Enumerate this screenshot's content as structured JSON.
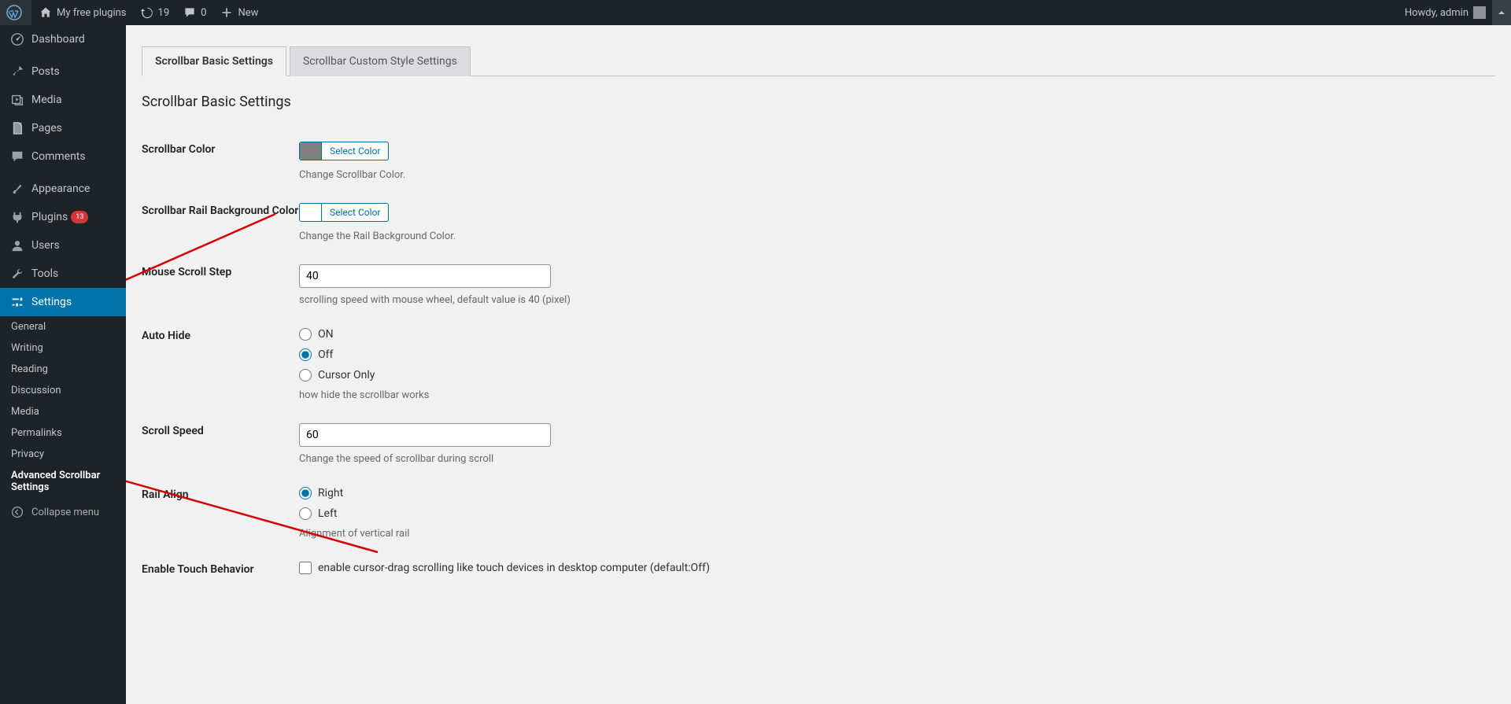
{
  "adminbar": {
    "site_name": "My free plugins",
    "updates_count": "19",
    "comments_count": "0",
    "new_label": "New",
    "howdy": "Howdy, admin"
  },
  "sidemenu": {
    "dashboard": "Dashboard",
    "posts": "Posts",
    "media": "Media",
    "pages": "Pages",
    "comments": "Comments",
    "appearance": "Appearance",
    "plugins": "Plugins",
    "plugins_badge": "13",
    "users": "Users",
    "tools": "Tools",
    "settings": "Settings",
    "sub_general": "General",
    "sub_writing": "Writing",
    "sub_reading": "Reading",
    "sub_discussion": "Discussion",
    "sub_media": "Media",
    "sub_permalinks": "Permalinks",
    "sub_privacy": "Privacy",
    "sub_advanced": "Advanced Scrollbar Settings",
    "collapse": "Collapse menu"
  },
  "tabs": {
    "basic": "Scrollbar Basic Settings",
    "custom": "Scrollbar Custom Style Settings"
  },
  "section_title": "Scrollbar Basic Settings",
  "fields": {
    "color": {
      "label": "Scrollbar Color",
      "button": "Select Color",
      "desc": "Change Scrollbar Color."
    },
    "rail_bg": {
      "label": "Scrollbar Rail Background Color",
      "button": "Select Color",
      "desc": "Change the Rail Background Color."
    },
    "scroll_step": {
      "label": "Mouse Scroll Step",
      "value": "40",
      "desc": "scrolling speed with mouse wheel, default value is 40 (pixel)"
    },
    "autohide": {
      "label": "Auto Hide",
      "opt_on": "ON",
      "opt_off": "Off",
      "opt_cursor": "Cursor Only",
      "desc": "how hide the scrollbar works"
    },
    "scroll_speed": {
      "label": "Scroll Speed",
      "value": "60",
      "desc": "Change the speed of scrollbar during scroll"
    },
    "rail_align": {
      "label": "Rail Align",
      "opt_right": "Right",
      "opt_left": "Left",
      "desc": "Alignment of vertical rail"
    },
    "touch": {
      "label": "Enable Touch Behavior",
      "opt": "enable cursor-drag scrolling like touch devices in desktop computer (default:Off)"
    }
  }
}
